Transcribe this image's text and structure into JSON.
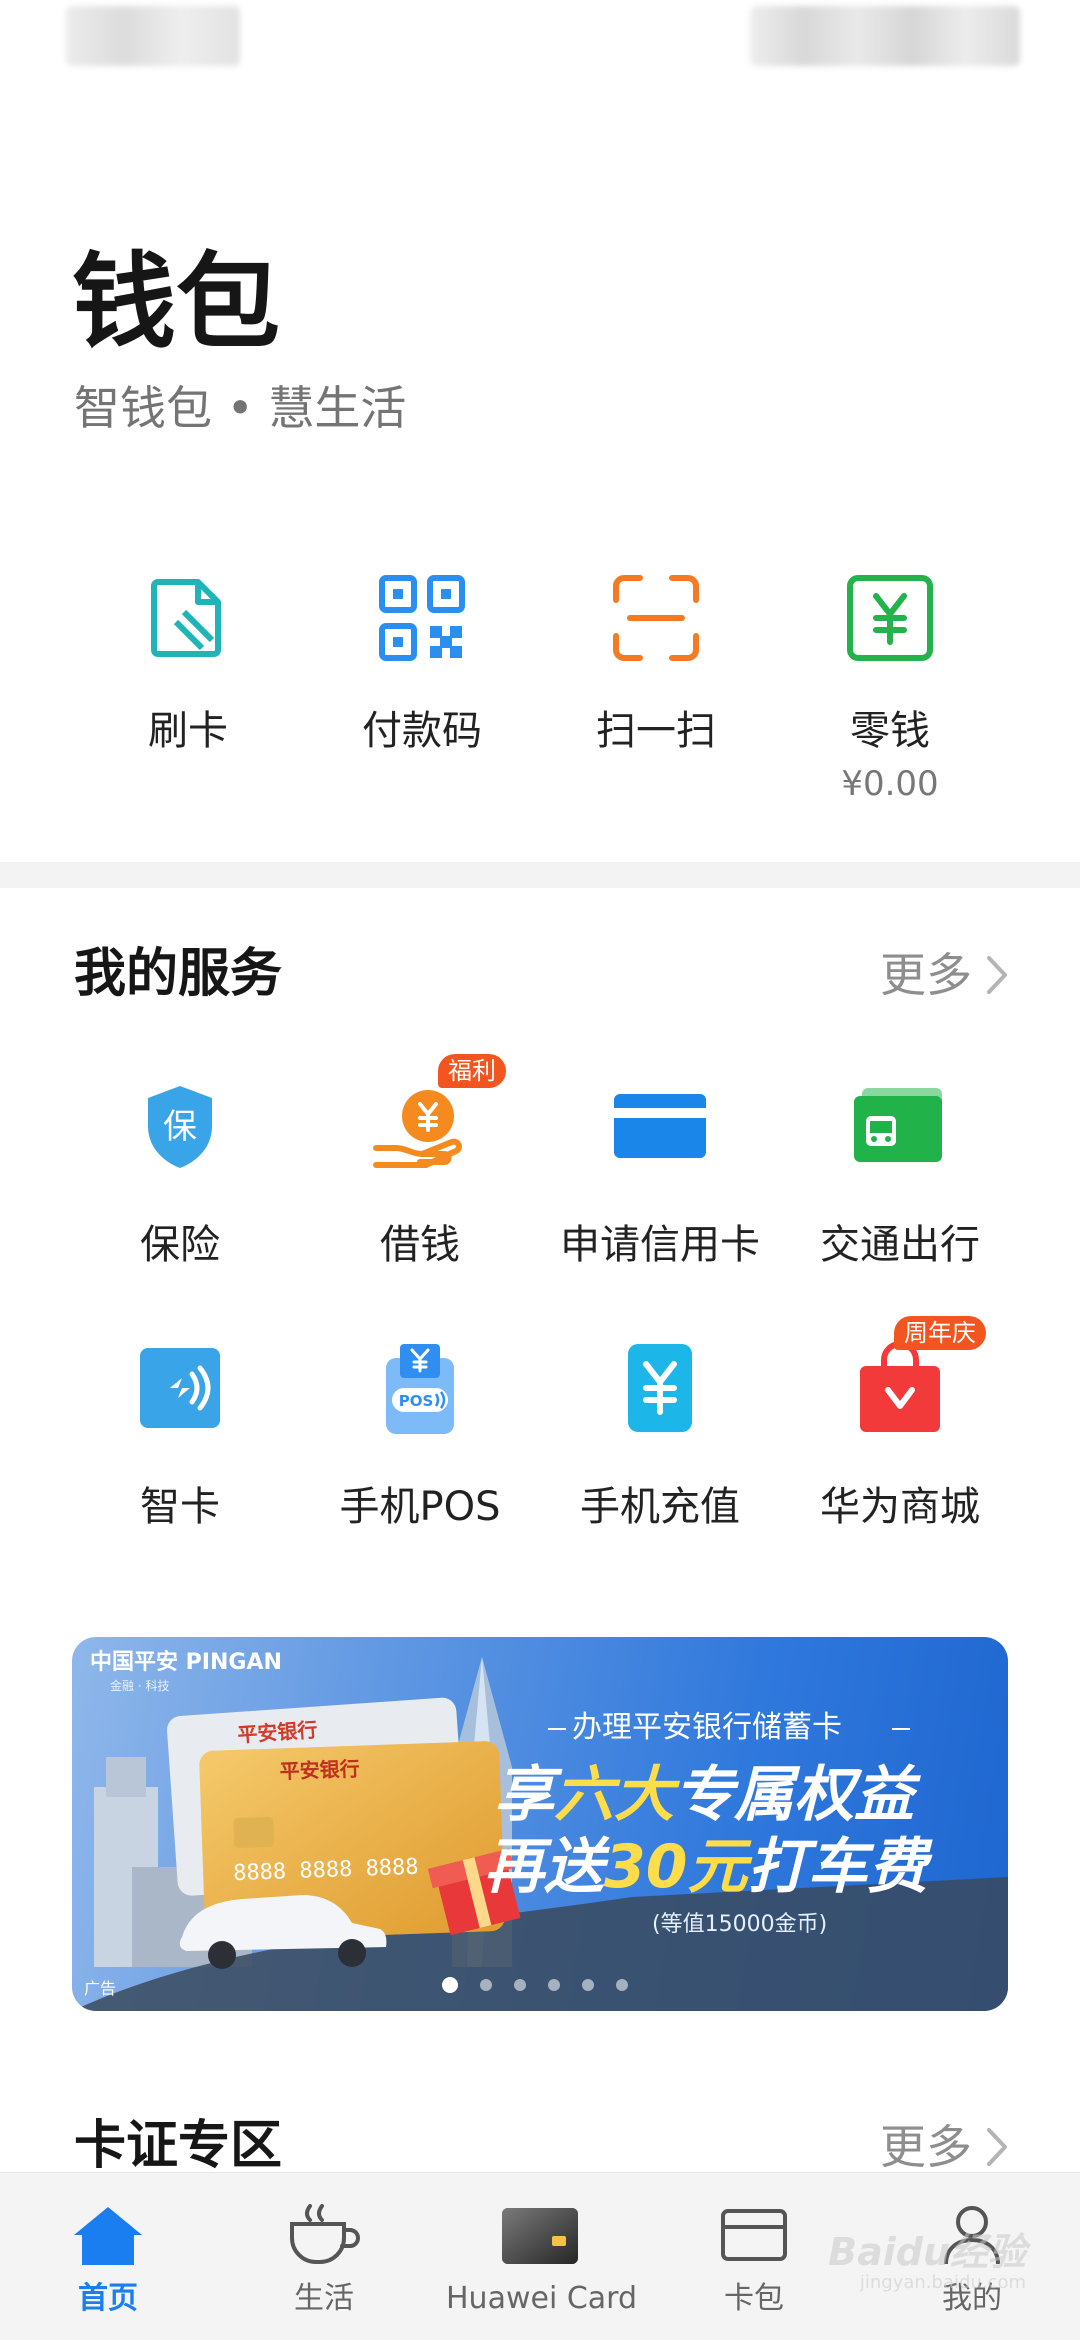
{
  "header": {
    "title": "钱包",
    "subtitle": "智钱包 • 慧生活"
  },
  "quick_actions": [
    {
      "label": "刷卡",
      "icon": "card-swipe-icon",
      "color": "#1fb5b8"
    },
    {
      "label": "付款码",
      "icon": "qr-code-icon",
      "color": "#2a8ff0"
    },
    {
      "label": "扫一扫",
      "icon": "scan-icon",
      "color": "#f47b22"
    },
    {
      "label": "零钱",
      "icon": "yuan-wallet-icon",
      "color": "#24b24a",
      "amount": "¥0.00"
    }
  ],
  "services": {
    "title": "我的服务",
    "more": "更多",
    "items": [
      {
        "label": "保险",
        "icon": "shield-insurance-icon",
        "color": "#3aa4e8"
      },
      {
        "label": "借钱",
        "icon": "hand-coin-icon",
        "color": "#f58a1f",
        "badge": "福利"
      },
      {
        "label": "申请信用卡",
        "icon": "credit-card-icon",
        "color": "#1a86ea"
      },
      {
        "label": "交通出行",
        "icon": "bus-card-icon",
        "color": "#22b24a"
      },
      {
        "label": "智卡",
        "icon": "nfc-card-icon",
        "color": "#3aa4e8"
      },
      {
        "label": "手机POS",
        "icon": "pos-terminal-icon",
        "color": "#2f8ef0"
      },
      {
        "label": "手机充值",
        "icon": "phone-recharge-icon",
        "color": "#1cb6e8"
      },
      {
        "label": "华为商城",
        "icon": "shopping-bag-icon",
        "color": "#f23a3a",
        "badge": "周年庆"
      }
    ]
  },
  "banner": {
    "brand": "中国平安 PINGAN",
    "brand_sub": "金融 · 科技",
    "headline": "办理平安银行储蓄卡",
    "line1_a": "享",
    "line1_b": "六大",
    "line1_c": "专属权益",
    "line2_a": "再送",
    "line2_b": "30元",
    "line2_c": "打车费",
    "note": "(等值15000金币)",
    "ad_label": "广告",
    "dots": 6,
    "active_dot": 0
  },
  "cards_section": {
    "title": "卡证专区",
    "more": "更多"
  },
  "bottom_nav": [
    {
      "label": "首页",
      "icon": "home-icon",
      "active": true
    },
    {
      "label": "生活",
      "icon": "coffee-cup-icon",
      "active": false
    },
    {
      "label": "Huawei Card",
      "icon": "huawei-card-icon",
      "active": false
    },
    {
      "label": "卡包",
      "icon": "card-wallet-icon",
      "active": false
    },
    {
      "label": "我的",
      "icon": "person-icon",
      "active": false
    }
  ],
  "watermark": {
    "text": "Baidu经验",
    "sub": "jingyan.baidu.com"
  }
}
